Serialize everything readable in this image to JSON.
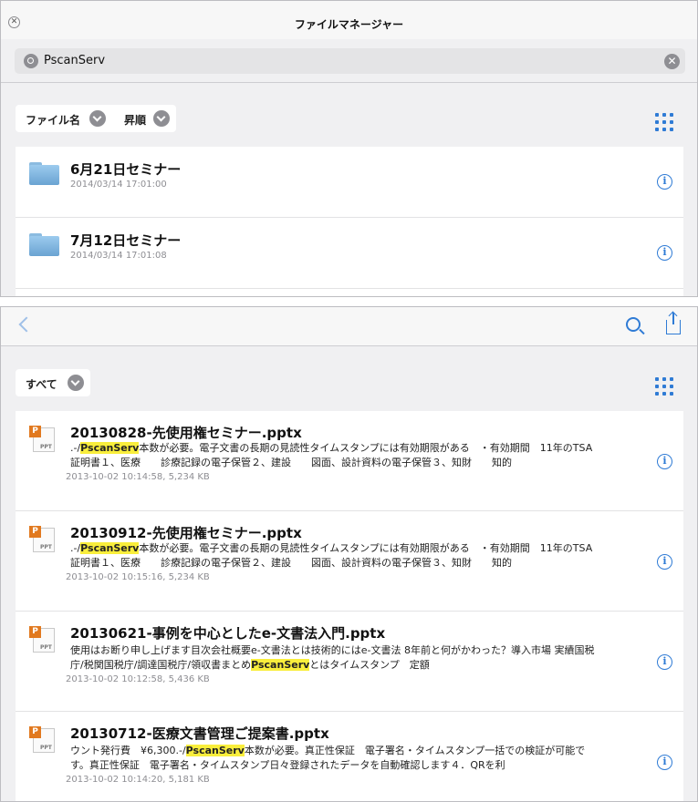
{
  "top_window": {
    "close_glyph": "✕",
    "title": "ファイルマネージャー",
    "search": {
      "value": "PscanServ",
      "clear_glyph": "✕"
    },
    "sort": {
      "field_label": "ファイル名",
      "order_label": "昇順"
    },
    "folders": [
      {
        "name": "6月21日セミナー",
        "date": "2014/03/14 17:01:00"
      },
      {
        "name": "7月12日セミナー",
        "date": "2014/03/14 17:01:08"
      }
    ]
  },
  "bottom_window": {
    "filter_label": "すべて",
    "documents": [
      {
        "title": "20130828-先使用権セミナー.pptx",
        "line1_pre": ".-/",
        "line1_hl": "PscanServ",
        "line1_post": "本数が必要。電子文書の長期の見読性タイムスタンプには有効期限がある　・有効期間　11年のTSA",
        "line2": "証明書１、医療　　診療記録の電子保管２、建設　　図面、設計資料の電子保管３、知財　　知的",
        "meta": "2013-10-02 10:14:58, 5,234 KB"
      },
      {
        "title": "20130912-先使用権セミナー.pptx",
        "line1_pre": ".-/",
        "line1_hl": "PscanServ",
        "line1_post": "本数が必要。電子文書の長期の見読性タイムスタンプには有効期限がある　・有効期間　11年のTSA",
        "line2": "証明書１、医療　　診療記録の電子保管２、建設　　図面、設計資料の電子保管３、知財　　知的",
        "meta": "2013-10-02 10:15:16, 5,234 KB"
      },
      {
        "title": "20130621-事例を中心としたe-文書法入門.pptx",
        "line1": "使用はお断り申し上げます目次会社概要e-文書法とは技術的にはe-文書法 8年前と何がかわった？導入市場 実績国税",
        "line2_pre": "庁/税関国税庁/調達国税庁/領収書まとめ",
        "line2_hl": "PscanServ",
        "line2_post": "とはタイムスタンプ　定額",
        "meta": "2013-10-02 10:12:58, 5,436 KB"
      },
      {
        "title": "20130712-医療文書管理ご提案書.pptx",
        "line1_pre": "ウント発行費　¥6,300.-/",
        "line1_hl": "PscanServ",
        "line1_post": "本数が必要。真正性保証　電子署名・タイムスタンプ一括での検証が可能で",
        "line2": "す。真正性保証　電子署名・タイムスタンプ日々登録されたデータを自動確認します４．QRを利",
        "meta": "2013-10-02 10:14:20, 5,181 KB"
      }
    ]
  },
  "icons": {
    "info_glyph": "i",
    "ppt_badge": "P",
    "ppt_label": "PPT"
  },
  "colors": {
    "accent": "#2f7bd5",
    "highlight": "#f9ee3c",
    "ppt": "#e1791f"
  }
}
